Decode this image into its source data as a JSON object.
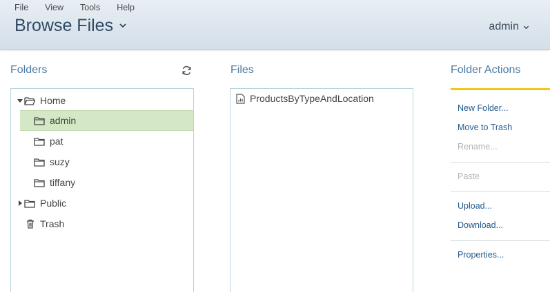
{
  "menubar": {
    "items": [
      "File",
      "View",
      "Tools",
      "Help"
    ]
  },
  "header": {
    "title": "Browse Files",
    "user": "admin"
  },
  "folders": {
    "title": "Folders",
    "tree": [
      {
        "label": "Home",
        "expanded": true,
        "icon": "folder-open-icon"
      },
      {
        "label": "admin",
        "selected": true,
        "icon": "folder-icon"
      },
      {
        "label": "pat",
        "icon": "folder-icon"
      },
      {
        "label": "suzy",
        "icon": "folder-icon"
      },
      {
        "label": "tiffany",
        "icon": "folder-icon"
      },
      {
        "label": "Public",
        "expanded": false,
        "icon": "folder-icon"
      },
      {
        "label": "Trash",
        "icon": "trash-icon"
      }
    ]
  },
  "files": {
    "title": "Files",
    "items": [
      {
        "label": "ProductsByTypeAndLocation",
        "icon": "report-file-icon"
      }
    ]
  },
  "actions": {
    "title": "Folder Actions",
    "accent_color": "#f2c61f",
    "items": [
      {
        "label": "New Folder...",
        "enabled": true
      },
      {
        "label": "Move to Trash",
        "enabled": true
      },
      {
        "label": "Rename...",
        "enabled": false
      },
      {
        "label": "Paste",
        "enabled": false
      },
      {
        "label": "Upload...",
        "enabled": true
      },
      {
        "label": "Download...",
        "enabled": true
      },
      {
        "label": "Properties...",
        "enabled": true
      }
    ]
  },
  "colors": {
    "selected_bg": "#d5e8c5",
    "link": "#245b8e",
    "panel_title": "#4c7aa6"
  }
}
